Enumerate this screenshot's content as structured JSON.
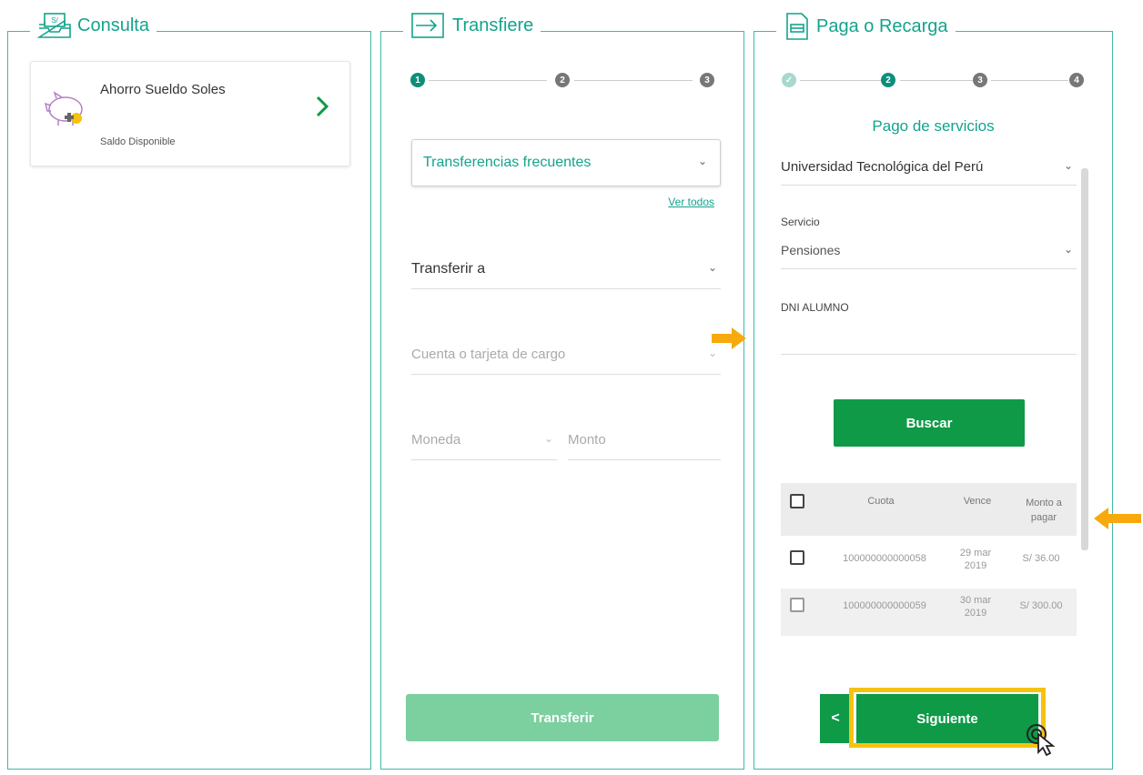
{
  "consulta": {
    "title": "Consulta",
    "account_name": "Ahorro Sueldo Soles",
    "saldo_label": "Saldo Disponible"
  },
  "transfiere": {
    "title": "Transfiere",
    "steps": [
      "1",
      "2",
      "3"
    ],
    "frequent_label": "Transferencias frecuentes",
    "ver_todos": "Ver todos",
    "transferir_a": "Transferir a",
    "cuenta_placeholder": "Cuenta o tarjeta de cargo",
    "moneda_placeholder": "Moneda",
    "monto_placeholder": "Monto",
    "submit_label": "Transferir"
  },
  "paga": {
    "title": "Paga o Recarga",
    "steps": [
      "✓",
      "2",
      "3",
      "4"
    ],
    "subtitle": "Pago de servicios",
    "company": "Universidad Tecnológica del Perú",
    "service_label": "Servicio",
    "service_value": "Pensiones",
    "dni_label": "DNI ALUMNO",
    "dni_value": "",
    "buscar_label": "Buscar",
    "table": {
      "headers": [
        "Cuota",
        "Vence",
        "Monto a pagar"
      ],
      "rows": [
        {
          "cuota": "100000000000058",
          "vence": "29 mar 2019",
          "monto": "S/ 36.00"
        },
        {
          "cuota": "100000000000059",
          "vence": "30 mar 2019",
          "monto": "S/ 300.00"
        }
      ]
    },
    "back_label": "<",
    "siguiente_label": "Siguiente"
  },
  "colors": {
    "teal": "#14a38c",
    "green": "#0e9a47",
    "highlight": "#f5c211",
    "arrow": "#f7a90d"
  }
}
